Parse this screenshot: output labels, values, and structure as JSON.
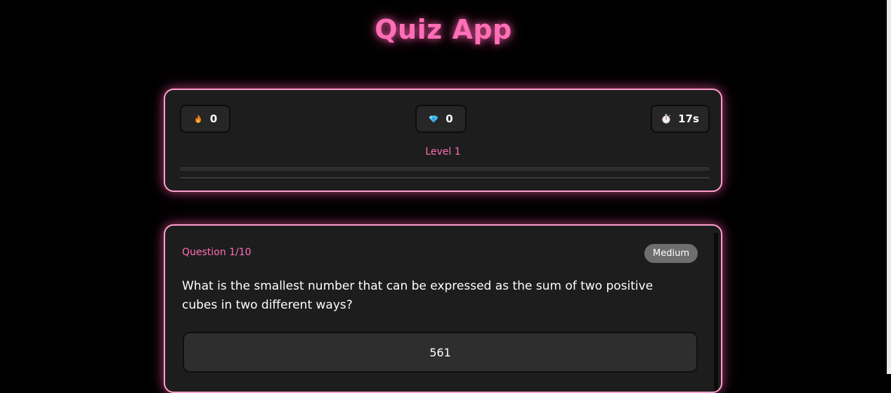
{
  "app": {
    "title": "Quiz App"
  },
  "stats": {
    "streak": {
      "icon": "fire-icon",
      "value": "0"
    },
    "gems": {
      "icon": "gem-icon",
      "value": "0"
    },
    "timer": {
      "icon": "stopwatch-icon",
      "value": "17s"
    },
    "level_label": "Level 1",
    "level_progress": 0
  },
  "question": {
    "counter": "Question 1/10",
    "difficulty": "Medium",
    "text": "What is the smallest number that can be expressed as the sum of two positive cubes in two different ways?",
    "options": [
      "561"
    ]
  },
  "colors": {
    "accent": "#ff6fb7",
    "card_border": "#ff9fcf",
    "card_background": "#1d1d1d",
    "page_background": "#000000"
  }
}
